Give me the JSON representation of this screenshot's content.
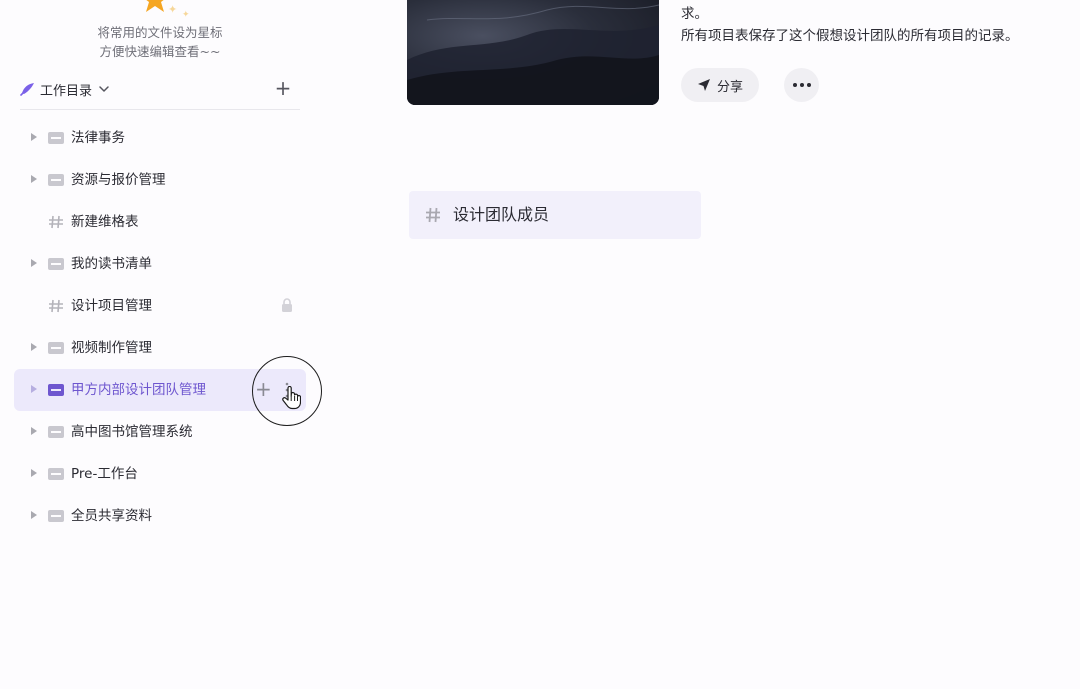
{
  "sidebar": {
    "star_hint_line1": "将常用的文件设为星标",
    "star_hint_line2": "方便快速编辑查看~~",
    "directory_title": "工作目录",
    "items": [
      {
        "label": "法律事务",
        "type": "folder",
        "expandable": true
      },
      {
        "label": "资源与报价管理",
        "type": "folder",
        "expandable": true
      },
      {
        "label": "新建维格表",
        "type": "sheet",
        "expandable": false
      },
      {
        "label": "我的读书清单",
        "type": "folder",
        "expandable": true
      },
      {
        "label": "设计项目管理",
        "type": "sheet",
        "expandable": false,
        "locked": true
      },
      {
        "label": "视频制作管理",
        "type": "folder",
        "expandable": true
      },
      {
        "label": "甲方内部设计团队管理",
        "type": "folder",
        "expandable": true,
        "active": true
      },
      {
        "label": "高中图书馆管理系统",
        "type": "folder",
        "expandable": true
      },
      {
        "label": "Pre-工作台",
        "type": "folder",
        "expandable": true
      },
      {
        "label": "全员共享资料",
        "type": "folder",
        "expandable": true
      }
    ]
  },
  "main": {
    "description_line1": "求。",
    "description_line2": "所有项目表保存了这个假想设计团队的所有项目的记录。",
    "share_label": "分享",
    "section_title": "设计团队成员"
  },
  "colors": {
    "accent": "#6e56cf",
    "active_bg": "#ece9fb",
    "star": "#f5a623"
  }
}
